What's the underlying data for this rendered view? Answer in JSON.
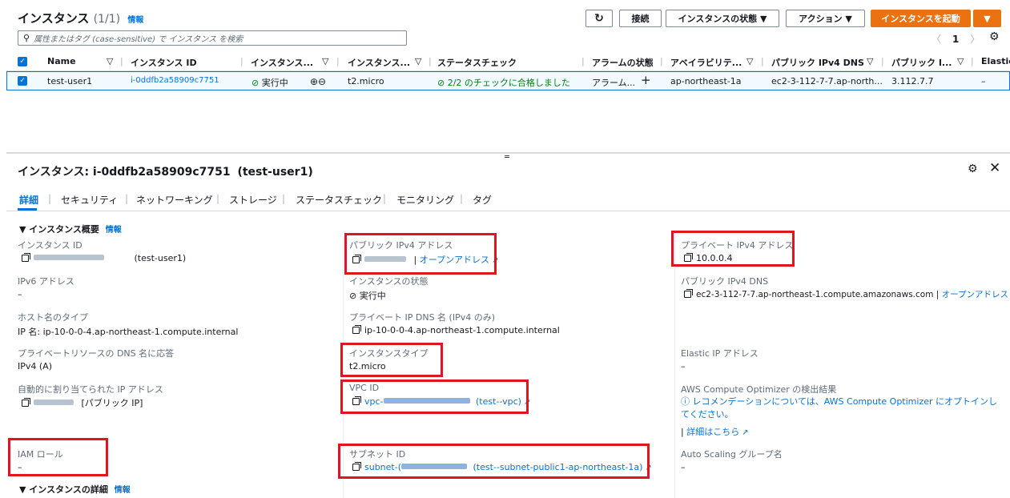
{
  "header": {
    "title": "インスタンス",
    "count": "(1/1)",
    "info": "情報",
    "search_placeholder": "属性またはタグ (case-sensitive) で インスタンス を検索",
    "buttons": {
      "connect": "接続",
      "instance_state": "インスタンスの状態 ▼",
      "actions": "アクション ▼",
      "launch": "インスタンスを起動",
      "launch_dropdown": "▼"
    },
    "pagination": {
      "page": "1"
    }
  },
  "table": {
    "columns": [
      "Name",
      "インスタンス ID",
      "インスタンス...",
      "インスタンス...",
      "ステータスチェック",
      "アラームの状態",
      "アベイラビリテ...",
      "パブリック IPv4 DNS",
      "パブリック I...",
      "Elastic"
    ],
    "row": {
      "name": "test-user1",
      "instance_id": "i-0ddfb2a58909c7751",
      "state": "実行中",
      "type": "t2.micro",
      "status_check": "2/2 のチェックに合格しました",
      "alarm": "アラーム...",
      "alarm_add": "+",
      "az": "ap-northeast-1a",
      "dns": "ec2-3-112-7-7.ap-north...",
      "ip": "3.112.7.7",
      "elastic": "–"
    }
  },
  "details": {
    "title_prefix": "インスタンス: i-0ddfb2a58909c7751",
    "title_name": "(test-user1)",
    "tabs": [
      "詳細",
      "セキュリティ",
      "ネットワーキング",
      "ストレージ",
      "ステータスチェック",
      "モニタリング",
      "タグ"
    ],
    "section_summary": "▼ インスタンス概要",
    "section_summary_info": "情報",
    "section_details": "▼ インスタンスの詳細",
    "section_details_info": "情報",
    "fields": {
      "instance_id_label": "インスタンス ID",
      "instance_id_name": "(test-user1)",
      "ipv6_label": "IPv6 アドレス",
      "ipv6_value": "–",
      "hostname_type_label": "ホスト名のタイプ",
      "hostname_type_value": "IP 名: ip-10-0-0-4.ap-northeast-1.compute.internal",
      "private_dns_answer_label": "プライベートリソースの DNS 名に応答",
      "private_dns_answer_value": "IPv4 (A)",
      "auto_ip_label": "自動的に割り当てられた IP アドレス",
      "auto_ip_suffix": "[パブリック IP]",
      "iam_role_label": "IAM ロール",
      "iam_role_value": "–",
      "public_ipv4_label": "パブリック IPv4 アドレス",
      "open_address": "オープンアドレス",
      "instance_state_label": "インスタンスの状態",
      "instance_state_value": "実行中",
      "private_ip_dns_label": "プライベート IP DNS 名 (IPv4 のみ)",
      "private_ip_dns_value": "ip-10-0-0-4.ap-northeast-1.compute.internal",
      "instance_type_label": "インスタンスタイプ",
      "instance_type_value": "t2.micro",
      "vpc_id_label": "VPC ID",
      "vpc_id_prefix": "vpc-",
      "vpc_id_name": "(test--vpc)",
      "subnet_id_label": "サブネット ID",
      "subnet_id_prefix": "subnet-(",
      "subnet_id_name": "(test--subnet-public1-ap-northeast-1a)",
      "private_ipv4_label": "プライベート IPv4 アドレス",
      "private_ipv4_value": "10.0.0.4",
      "public_dns_label": "パブリック IPv4 DNS",
      "public_dns_value": "ec2-3-112-7-7.ap-northeast-1.compute.amazonaws.com",
      "public_dns_sep": "|",
      "public_dns_open": "オープンアドレス",
      "elastic_ip_label": "Elastic IP アドレス",
      "elastic_ip_value": "–",
      "optimizer_label": "AWS Compute Optimizer の検出結果",
      "optimizer_text": "レコメンデーションについては、AWS Compute Optimizer にオプトインしてください。",
      "optimizer_link": "詳細はこちら",
      "asg_label": "Auto Scaling グループ名",
      "asg_value": "–"
    }
  },
  "colors": {
    "accent": "#0972d3",
    "orange": "#ec7211",
    "green": "#037f0c",
    "highlight": "#e0151f"
  }
}
